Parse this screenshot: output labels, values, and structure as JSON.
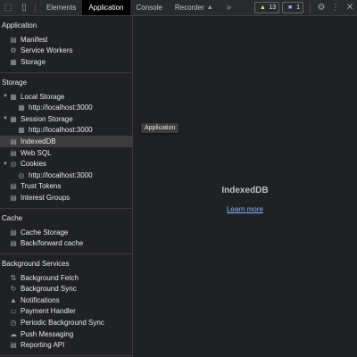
{
  "toolbar": {
    "tabs": [
      {
        "label": "Elements",
        "active": false
      },
      {
        "label": "Application",
        "active": true
      },
      {
        "label": "Console",
        "active": false
      },
      {
        "label": "Recorder",
        "active": false
      }
    ],
    "more": "»",
    "warnings_count": "13",
    "messages_count": "1"
  },
  "sidebar": {
    "application": {
      "title": "Application",
      "items": [
        "Manifest",
        "Service Workers",
        "Storage"
      ]
    },
    "storage": {
      "title": "Storage",
      "local_storage": "Local Storage",
      "local_storage_origin": "http://localhost:3000",
      "session_storage": "Session Storage",
      "session_storage_origin": "http://localhost:3000",
      "indexeddb": "IndexedDB",
      "websql": "Web SQL",
      "cookies": "Cookies",
      "cookies_origin": "http://localhost:3000",
      "trust_tokens": "Trust Tokens",
      "interest_groups": "Interest Groups"
    },
    "cache": {
      "title": "Cache",
      "items": [
        "Cache Storage",
        "Back/forward cache"
      ]
    },
    "background_services": {
      "title": "Background Services",
      "items": [
        "Background Fetch",
        "Background Sync",
        "Notifications",
        "Payment Handler",
        "Periodic Background Sync",
        "Push Messaging",
        "Reporting API"
      ]
    }
  },
  "main": {
    "tooltip": "Application",
    "title": "IndexedDB",
    "link": "Learn more"
  },
  "colors": {
    "background": "#202124",
    "selected_row": "#3c3c3c",
    "link": "#8ab4f8"
  }
}
